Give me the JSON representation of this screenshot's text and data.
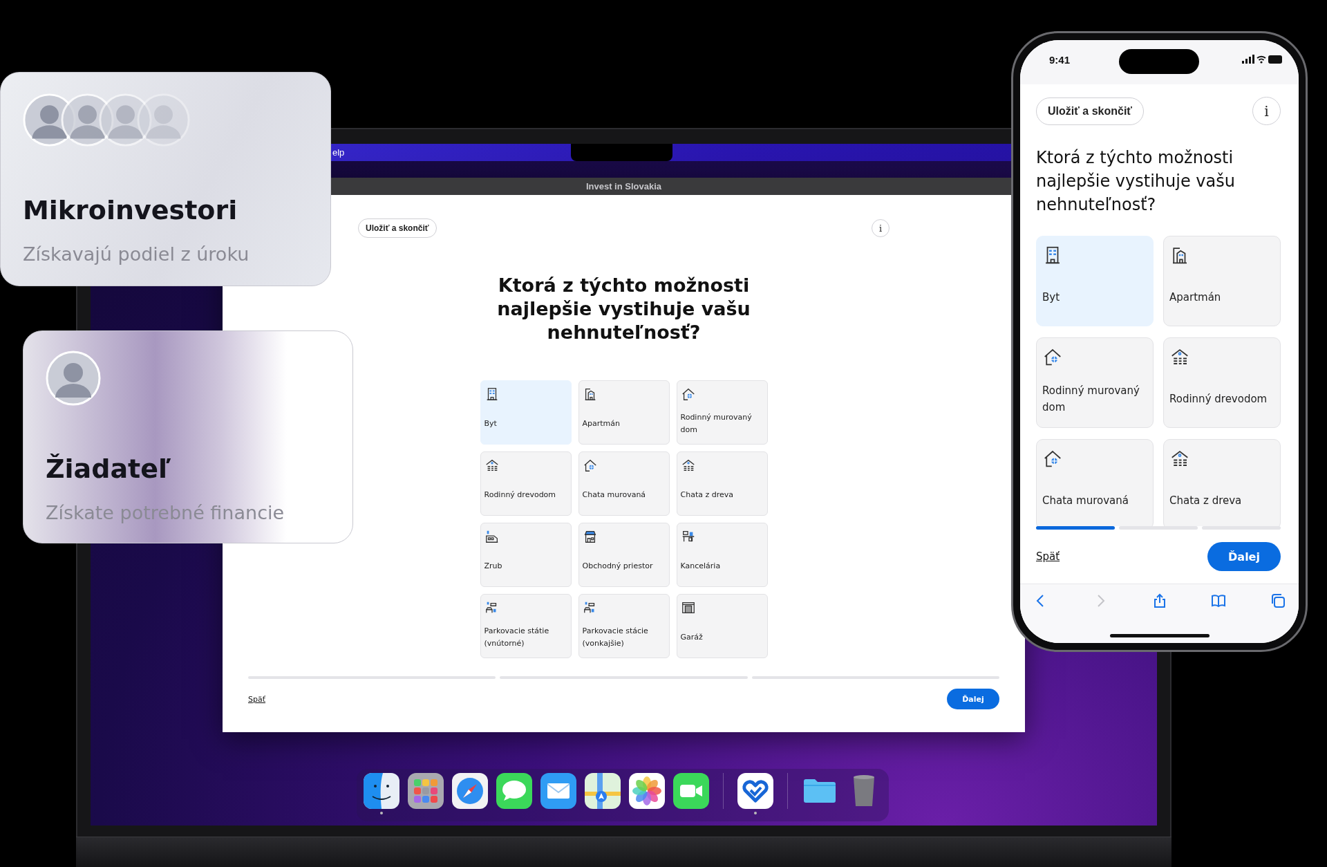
{
  "promo_cards": [
    {
      "kind": "group",
      "title": "Mikroinvestori",
      "subtitle": "Získavajú podiel z úroku"
    },
    {
      "kind": "single",
      "title": "Žiadateľ",
      "subtitle": "Získate potrebné financie"
    }
  ],
  "laptop": {
    "menu_bar": {
      "menu_item": "elp"
    },
    "window": {
      "title": "Invest in Slovakia"
    },
    "page": {
      "save_button": "Uložiť a skončiť",
      "info_button": "i",
      "question": "Ktorá z týchto možnosti najlepšie vystihuje vašu nehnuteľnosť?",
      "options": [
        {
          "kind": "building",
          "label": "Byt",
          "selected": true
        },
        {
          "kind": "apartment",
          "label": "Apartmán",
          "selected": false
        },
        {
          "kind": "house",
          "label": "Rodinný murovaný dom",
          "selected": false
        },
        {
          "kind": "cabin",
          "label": "Rodinný drevodom",
          "selected": false
        },
        {
          "kind": "house",
          "label": "Chata murovaná",
          "selected": false
        },
        {
          "kind": "cabin",
          "label": "Chata z dreva",
          "selected": false
        },
        {
          "kind": "log",
          "label": "Zrub",
          "selected": false
        },
        {
          "kind": "shop",
          "label": "Obchodný priestor",
          "selected": false
        },
        {
          "kind": "desk",
          "label": "Kancelária",
          "selected": false
        },
        {
          "kind": "parking",
          "label": "Parkovacie státie (vnútorné)",
          "selected": false
        },
        {
          "kind": "parking",
          "label": "Parkovacie stácie (vonkajšie)",
          "selected": false
        },
        {
          "kind": "garage",
          "label": "Garáž",
          "selected": false
        }
      ],
      "progress": [
        {
          "active": false
        },
        {
          "active": false
        },
        {
          "active": false
        }
      ],
      "back_link": "Späť",
      "next_button": "Ďalej"
    },
    "dock": [
      {
        "kind": "finder",
        "running": true
      },
      {
        "kind": "grid",
        "running": false
      },
      {
        "kind": "compass",
        "running": false
      },
      {
        "kind": "messages",
        "running": false
      },
      {
        "kind": "mail",
        "running": false
      },
      {
        "kind": "maps",
        "running": false
      },
      {
        "kind": "photos",
        "running": false
      },
      {
        "kind": "video",
        "running": false
      },
      {
        "kind": "heart",
        "running": true
      },
      {
        "kind": "folder",
        "running": false
      },
      {
        "kind": "trash",
        "running": false
      }
    ]
  },
  "phone": {
    "status_bar": {
      "time": "9:41"
    },
    "page": {
      "save_button": "Uložiť a skončiť",
      "info_button": "i",
      "question": "Ktorá z týchto možnosti najlepšie vystihuje vašu nehnuteľnosť?",
      "options": [
        {
          "kind": "building",
          "label": "Byt",
          "selected": true
        },
        {
          "kind": "apartment",
          "label": "Apartmán",
          "selected": false
        },
        {
          "kind": "house",
          "label": "Rodinný murovaný dom",
          "selected": false
        },
        {
          "kind": "cabin",
          "label": "Rodinný drevodom",
          "selected": false
        },
        {
          "kind": "house",
          "label": "Chata murovaná",
          "selected": false
        },
        {
          "kind": "cabin",
          "label": "Chata z dreva",
          "selected": false
        }
      ],
      "progress": [
        {
          "active": true
        },
        {
          "active": false
        },
        {
          "active": false
        }
      ],
      "back_link": "Späť",
      "next_button": "Ďalej"
    },
    "browser_toolbar": [
      {
        "kind": "back",
        "disabled": false
      },
      {
        "kind": "forward",
        "disabled": true
      },
      {
        "kind": "share",
        "disabled": false
      },
      {
        "kind": "bookmarks",
        "disabled": false
      },
      {
        "kind": "tabs",
        "disabled": false
      }
    ]
  }
}
